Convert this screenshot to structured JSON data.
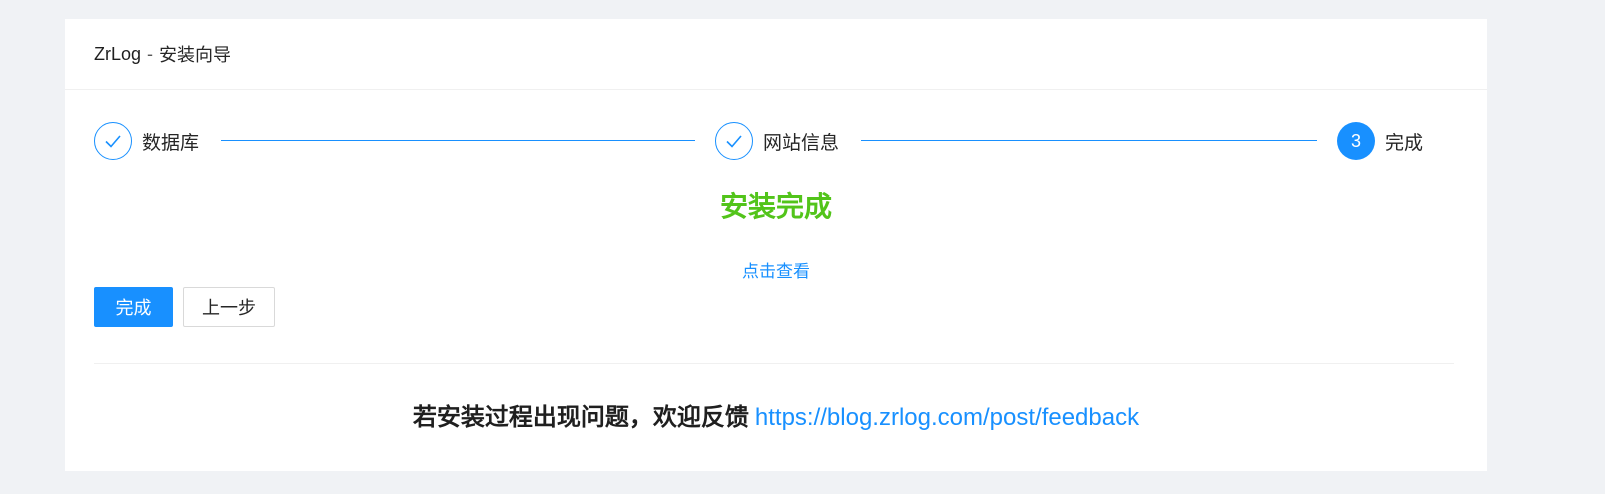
{
  "header": {
    "brand": "ZrLog",
    "separator": "-",
    "subtitle": "安装向导"
  },
  "steps": [
    {
      "number": "1",
      "title": "数据库",
      "status": "finished",
      "icon": "check-icon"
    },
    {
      "number": "2",
      "title": "网站信息",
      "status": "finished",
      "icon": "check-icon"
    },
    {
      "number": "3",
      "title": "完成",
      "status": "current"
    }
  ],
  "result": {
    "title": "安装完成",
    "link_text": "点击查看"
  },
  "actions": {
    "finish_label": "完成",
    "prev_label": "上一步"
  },
  "feedback": {
    "text": "若安装过程出现问题，欢迎反馈",
    "link": "https://blog.zrlog.com/post/feedback"
  },
  "colors": {
    "accent": "#1890ff",
    "success": "#52c41a",
    "background": "#f0f2f5"
  }
}
